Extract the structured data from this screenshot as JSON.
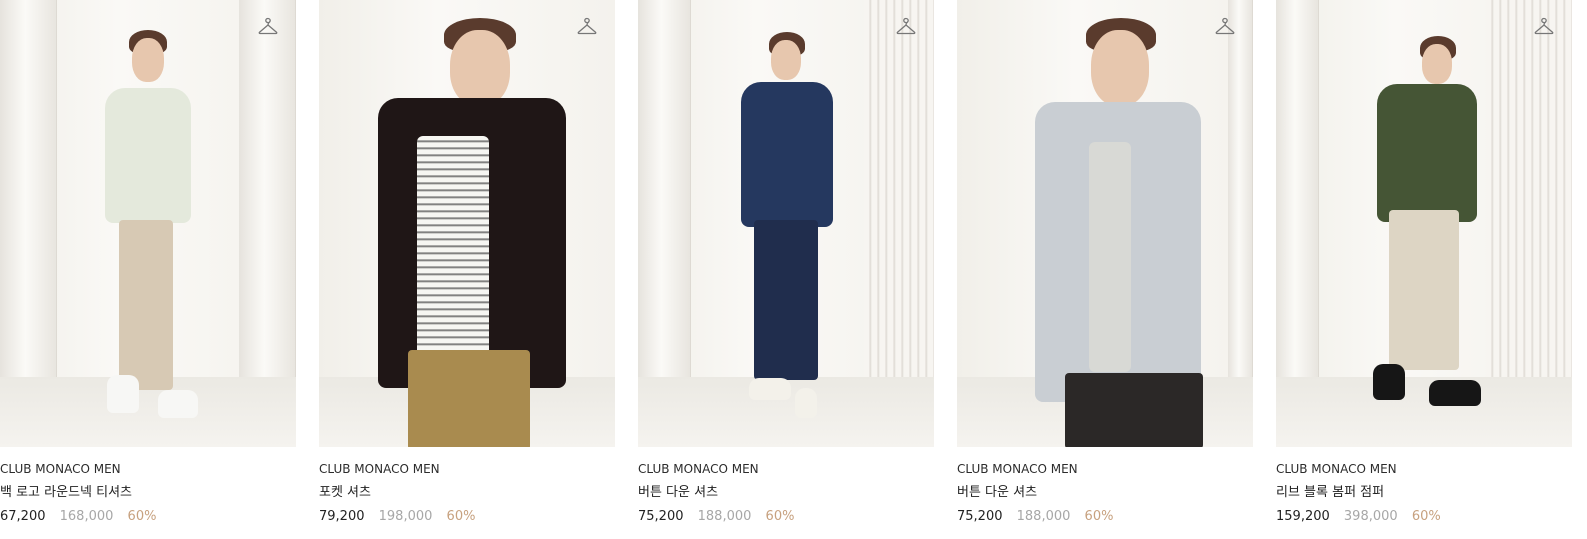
{
  "products": [
    {
      "brand": "CLUB MONACO MEN",
      "name": "백 로고 라운드넥 티셔츠",
      "price": "67,200",
      "original_price": "168,000",
      "discount": "60%",
      "icon": "hanger-icon"
    },
    {
      "brand": "CLUB MONACO MEN",
      "name": "포켓 셔츠",
      "price": "79,200",
      "original_price": "198,000",
      "discount": "60%",
      "icon": "hanger-icon"
    },
    {
      "brand": "CLUB MONACO MEN",
      "name": "버튼 다운 셔츠",
      "price": "75,200",
      "original_price": "188,000",
      "discount": "60%",
      "icon": "hanger-icon"
    },
    {
      "brand": "CLUB MONACO MEN",
      "name": "버튼 다운 셔츠",
      "price": "75,200",
      "original_price": "188,000",
      "discount": "60%",
      "icon": "hanger-icon"
    },
    {
      "brand": "CLUB MONACO MEN",
      "name": "리브 블록 봄퍼 점퍼",
      "price": "159,200",
      "original_price": "398,000",
      "discount": "60%",
      "icon": "hanger-icon"
    }
  ],
  "colors": {
    "discount": "#c7a17f",
    "original_price": "#a7a7a7",
    "text": "#222222"
  }
}
